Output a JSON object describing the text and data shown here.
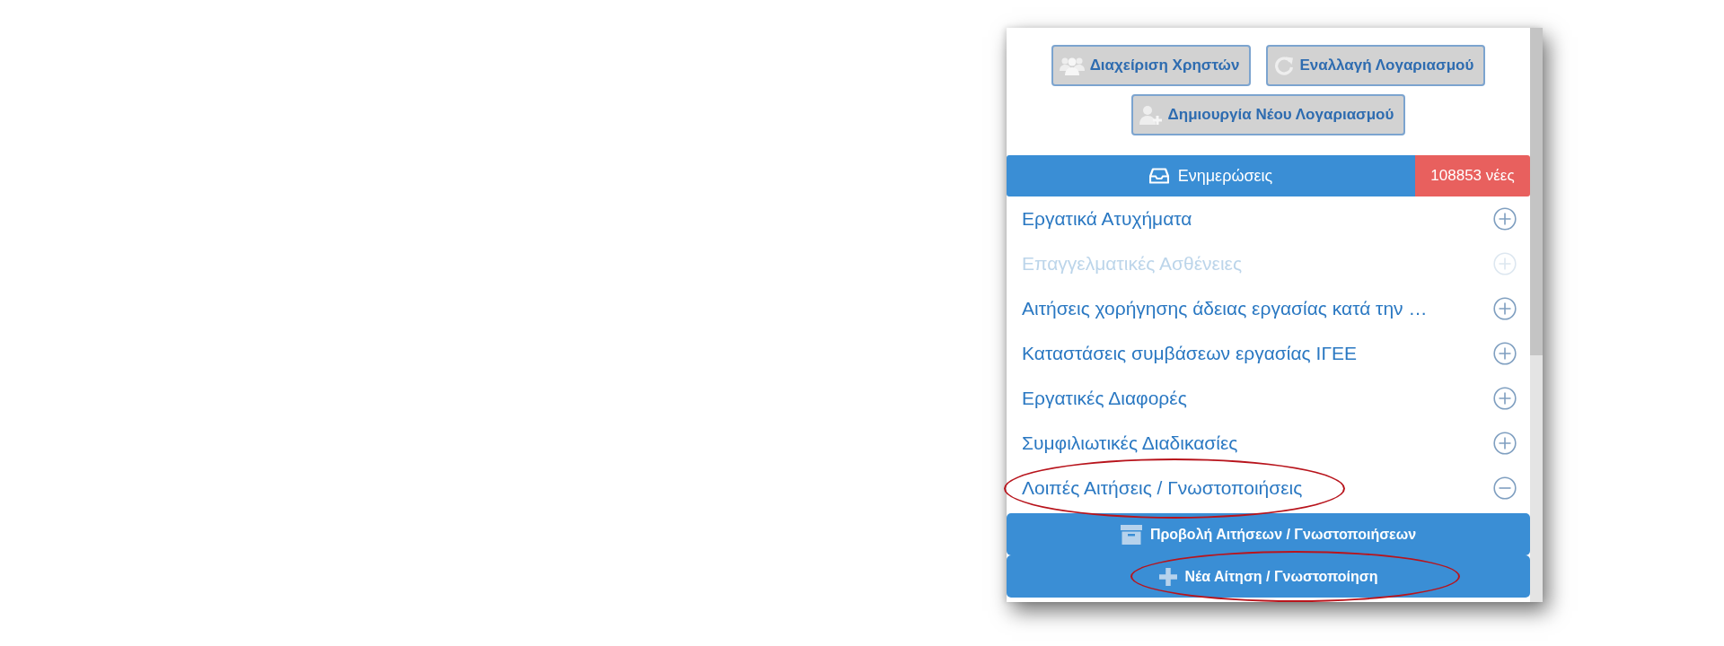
{
  "account_buttons": [
    "Διαχείριση Χρηστών",
    "Εναλλαγή Λογαριασμού",
    "Δημιουργία Νέου Λογαριασμού"
  ],
  "updates": {
    "label": "Ενημερώσεις",
    "badge": "108853 νέες"
  },
  "sections": [
    {
      "label": "Εργατικά Ατυχήματα",
      "disabled": false,
      "expanded": false,
      "highlighted": false
    },
    {
      "label": "Επαγγελματικές Ασθένειες",
      "disabled": true,
      "expanded": false,
      "highlighted": false
    },
    {
      "label": "Αιτήσεις χορήγησης άδειας εργασίας κατά την …",
      "disabled": false,
      "expanded": false,
      "highlighted": false
    },
    {
      "label": "Καταστάσεις συμβάσεων εργασίας ΙΓΕΕ",
      "disabled": false,
      "expanded": false,
      "highlighted": false
    },
    {
      "label": "Εργατικές Διαφορές",
      "disabled": false,
      "expanded": false,
      "highlighted": false
    },
    {
      "label": "Συμφιλιωτικές Διαδικασίες",
      "disabled": false,
      "expanded": false,
      "highlighted": false
    },
    {
      "label": "Λοιπές Αιτήσεις / Γνωστοποιήσεις",
      "disabled": false,
      "expanded": true,
      "highlighted": true,
      "children": [
        {
          "label": "Προβολή Αιτήσεων / Γνωστοποιήσεων",
          "highlighted": false
        },
        {
          "label": "Νέα Αίτηση / Γνωστοποίηση",
          "highlighted": true
        }
      ]
    }
  ]
}
